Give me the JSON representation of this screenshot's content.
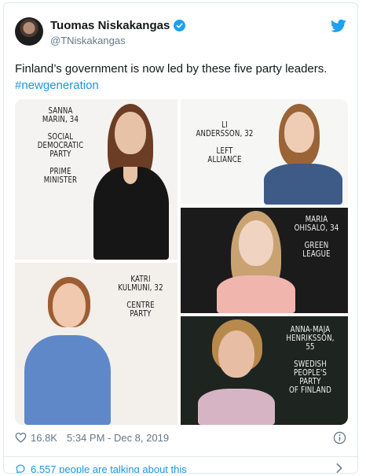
{
  "author": {
    "display_name": "Tuomas Niskakangas",
    "handle": "@TNiskakangas"
  },
  "tweet": {
    "text": "Finland’s government is now led by these five party leaders. ",
    "hashtag": "#newgeneration"
  },
  "photos": [
    {
      "caption": "Sanna\nMarin, 34\n\nSocial\nDemocratic\nParty\n\nPrime\nMinister"
    },
    {
      "caption": "Li\nAndersson, 32\n\nLeft\nAlliance"
    },
    {
      "caption": "Maria\nOhisalo, 34\n\nGreen\nLeague"
    },
    {
      "caption": "Katri\nKulmuni, 32\n\nCentre\nParty"
    },
    {
      "caption": "Anna-Maja\nHenriksson, 55\n\nSwedish\nPeople's\nParty\nof Finland"
    }
  ],
  "footer": {
    "likes": "16.8K",
    "timestamp": "5:34 PM - Dec 8, 2019"
  },
  "conversation": {
    "label": "6,557 people are talking about this"
  },
  "colors": {
    "brand_blue": "#1da1f2",
    "link_blue": "#1b95e0",
    "muted": "#657786"
  },
  "icons": [
    "avatar",
    "verified-badge-icon",
    "twitter-bird-icon",
    "heart-icon",
    "info-icon",
    "comment-bubble-icon",
    "chevron-right-icon"
  ]
}
